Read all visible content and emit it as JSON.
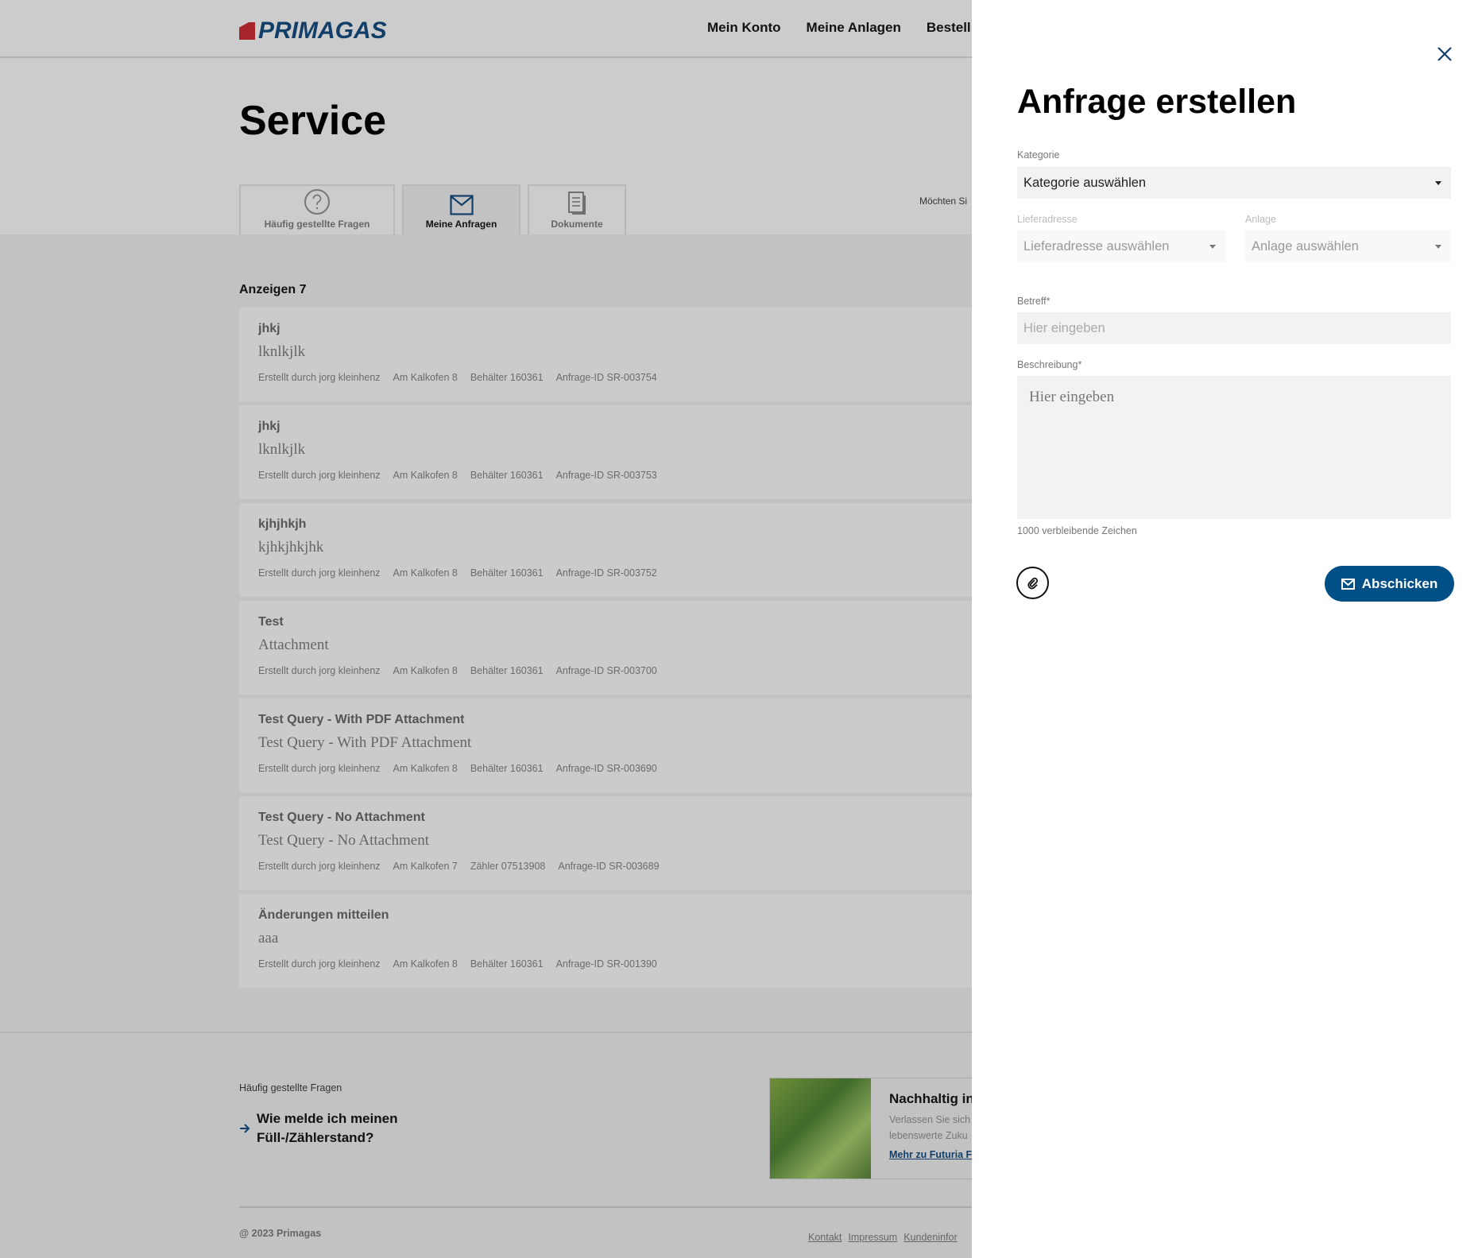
{
  "brand": {
    "name": "PRIMAGAS",
    "logo_color": "#123f69",
    "mark_color": "#a8242b"
  },
  "nav": [
    {
      "label": "Mein Konto"
    },
    {
      "label": "Meine Anlagen"
    },
    {
      "label": "Bestell"
    }
  ],
  "page_title": "Service",
  "tabs": [
    {
      "label": "Häufig gestellte Fragen",
      "icon": "question-circle-icon",
      "active": false
    },
    {
      "label": "Meine Anfragen",
      "icon": "envelope-icon",
      "active": true
    },
    {
      "label": "Dokumente",
      "icon": "document-icon",
      "active": false
    }
  ],
  "aside_text": "Möchten Si",
  "list": {
    "count_label": "Anzeigen 7",
    "items": [
      {
        "title": "jhkj",
        "description": "lknlkjlk",
        "author": "Erstellt durch jorg kleinhenz",
        "address": "Am Kalkofen 8",
        "device": "Behälter 160361",
        "id": "Anfrage-ID SR-003754"
      },
      {
        "title": "jhkj",
        "description": "lknlkjlk",
        "author": "Erstellt durch jorg kleinhenz",
        "address": "Am Kalkofen 8",
        "device": "Behälter 160361",
        "id": "Anfrage-ID SR-003753"
      },
      {
        "title": "kjhjhkjh",
        "description": "kjhkjhkjhk",
        "author": "Erstellt durch jorg kleinhenz",
        "address": "Am Kalkofen 8",
        "device": "Behälter 160361",
        "id": "Anfrage-ID SR-003752"
      },
      {
        "title": "Test",
        "description": "Attachment",
        "author": "Erstellt durch jorg kleinhenz",
        "address": "Am Kalkofen 8",
        "device": "Behälter 160361",
        "id": "Anfrage-ID SR-003700"
      },
      {
        "title": "Test Query - With PDF Attachment",
        "description": "Test Query - With PDF Attachment",
        "author": "Erstellt durch jorg kleinhenz",
        "address": "Am Kalkofen 8",
        "device": "Behälter 160361",
        "id": "Anfrage-ID SR-003690"
      },
      {
        "title": "Test Query - No Attachment",
        "description": "Test Query - No Attachment",
        "author": "Erstellt durch jorg kleinhenz",
        "address": "Am Kalkofen 7",
        "device": "Zähler 07513908",
        "id": "Anfrage-ID SR-003689"
      },
      {
        "title": "Änderungen mitteilen",
        "description": "aaa",
        "author": "Erstellt durch jorg kleinhenz",
        "address": "Am Kalkofen 8",
        "device": "Behälter 160361",
        "id": "Anfrage-ID SR-001390"
      }
    ]
  },
  "footer": {
    "faq_label": "Häufig gestellte Fragen",
    "faq_link_line1": "Wie melde ich meinen",
    "faq_link_line2": "Füll-/Zählerstand?",
    "promo_title": "Nachhaltig in",
    "promo_text_line1": "Verlassen Sie sich",
    "promo_text_line2": "lebenswerte Zuku",
    "promo_link": "Mehr zu Futuria F",
    "copyright": "@ 2023 Primagas",
    "links": [
      "Kontakt",
      "Impressum",
      "Kundeninfor"
    ]
  },
  "panel": {
    "title": "Anfrage erstellen",
    "kategorie_label": "Kategorie",
    "kategorie_value": "Kategorie auswählen",
    "lieferadresse_label": "Lieferadresse",
    "lieferadresse_value": "Lieferadresse auswählen",
    "anlage_label": "Anlage",
    "anlage_value": "Anlage auswählen",
    "betreff_label": "Betreff*",
    "betreff_placeholder": "Hier eingeben",
    "beschreibung_label": "Beschreibung*",
    "beschreibung_placeholder": "Hier eingeben",
    "counter": "1000 verbleibende Zeichen",
    "submit_label": "Abschicken",
    "accent": "#004f87"
  }
}
